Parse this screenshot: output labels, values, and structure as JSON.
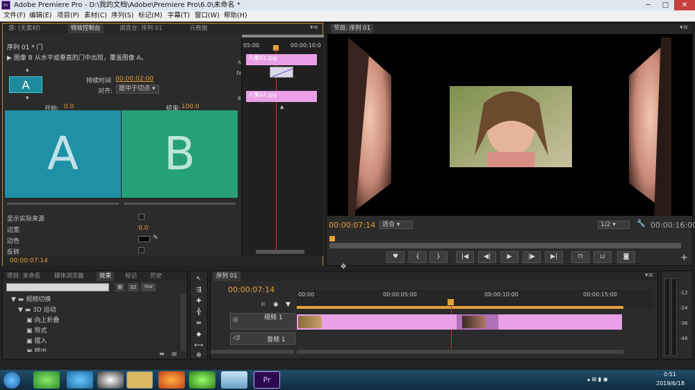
{
  "window": {
    "title": "Adobe Premiere Pro - D:\\我的文档\\Adobe\\Premiere Pro\\6.0\\未命名 *",
    "app_icon": "Pr"
  },
  "menu": [
    "文件(F)",
    "编辑(E)",
    "项目(P)",
    "素材(C)",
    "序列(S)",
    "标记(M)",
    "字幕(T)",
    "窗口(W)",
    "帮助(H)"
  ],
  "source_panel": {
    "tabs": [
      "源: (无素材)",
      "特效控制台",
      "调音台: 序列 01",
      "元数据"
    ],
    "header": "序列 01 * 门",
    "description": "图像 B 从水平或垂直的门中出现，覆盖图像 A。",
    "duration_label": "持续时间",
    "duration_value": "00:00:02:00",
    "align_label": "对齐:",
    "align_value": "居中于切点",
    "start_label": "开始:",
    "start_value": "0.0",
    "end_label": "结束:",
    "end_value": "100.0",
    "thumb_a": "A",
    "thumb_b": "B",
    "thumb_icon": "A",
    "show_source": "显示实际来源",
    "border_width": "边宽",
    "border_width_value": "0.0",
    "border_color": "边色",
    "reverse": "反转",
    "time": "00:00:07:14",
    "mini_ruler": [
      "05:00",
      "00:00:10:0"
    ],
    "clip_a": "人像01.jpg",
    "clip_b": "人像02.jpg",
    "track_a": "A",
    "track_b": "B",
    "fx": "fx"
  },
  "program": {
    "tab": "节目: 序列 01",
    "time": "00:00:07:14",
    "fit": "适合",
    "ratio": "1/2",
    "duration": "00:00:16:00"
  },
  "project": {
    "tabs": [
      "项目: 未命名",
      "媒体浏览器",
      "效果",
      "标记",
      "历史"
    ],
    "tree": [
      {
        "label": "视频切换",
        "level": 0,
        "arrow": "▼"
      },
      {
        "label": "3D 运动",
        "level": 1,
        "arrow": "▼"
      },
      {
        "label": "向上折叠",
        "level": 2
      },
      {
        "label": "帘式",
        "level": 2
      },
      {
        "label": "摆入",
        "level": 2
      },
      {
        "label": "摆出",
        "level": 2
      }
    ],
    "badges": [
      "32",
      "YUV"
    ]
  },
  "timeline": {
    "tab": "序列 01",
    "time": "00:00:07:14",
    "ruler": [
      "00:00",
      "00:00:05:00",
      "00:00:10:00",
      "00:00:15:00"
    ],
    "video_track": "视频 1",
    "audio_track": "音频 1"
  },
  "meter": {
    "labels": [
      "-12",
      "-24",
      "-36",
      "-48"
    ]
  },
  "clock": {
    "time": "0:51",
    "date": "2019/6/18"
  }
}
